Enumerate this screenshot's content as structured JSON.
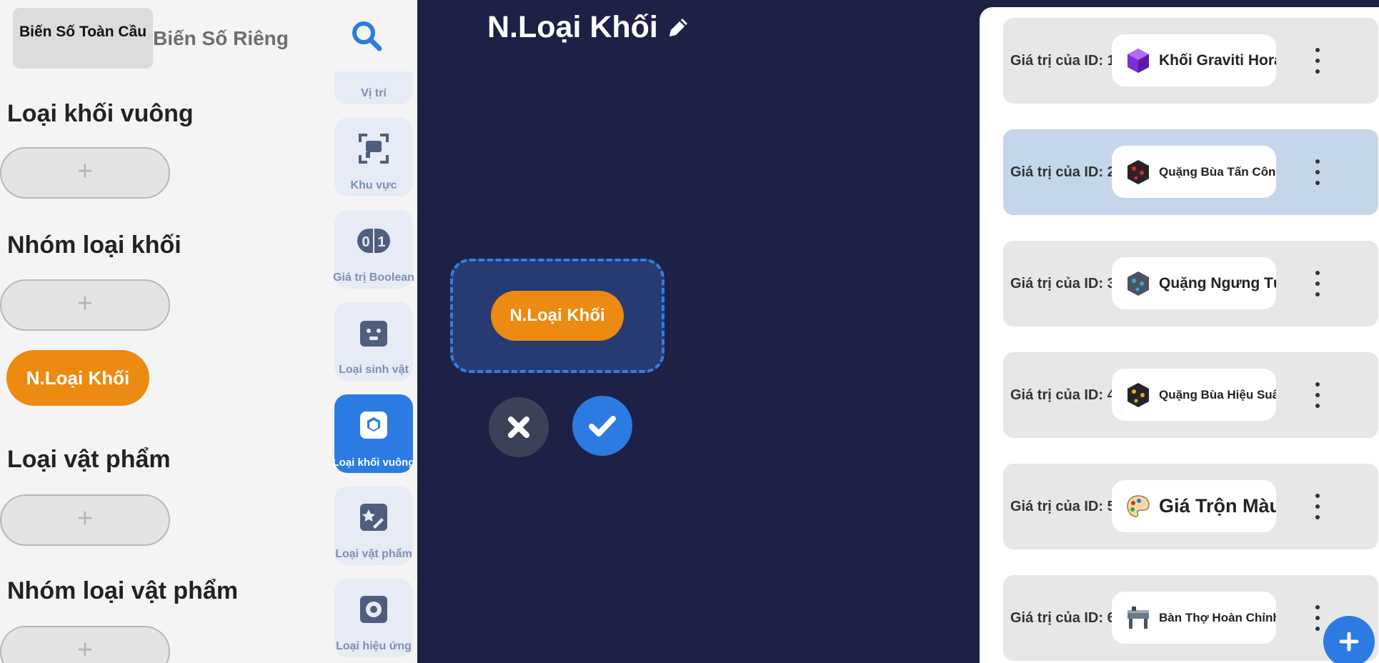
{
  "left_panel": {
    "tabs": [
      {
        "label": "Biến Số Toàn Cầu",
        "active": true
      },
      {
        "label": "Biến Số Riêng",
        "active": false
      }
    ],
    "sections": [
      {
        "title": "Loại khối vuông",
        "add_symbol": "+"
      },
      {
        "title": "Nhóm loại khối",
        "add_symbol": "+"
      },
      {
        "title": "Loại vật phẩm",
        "add_symbol": "+"
      },
      {
        "title": "Nhóm loại vật phẩm",
        "add_symbol": "+"
      }
    ],
    "variable_pill": "N.Loại Khối"
  },
  "rail": {
    "search_icon": "search-icon",
    "items": [
      {
        "label": "Vị trí",
        "icon": "location-icon",
        "active": false
      },
      {
        "label": "Khu vực",
        "icon": "area-icon",
        "active": false
      },
      {
        "label": "Giá trị Boolean",
        "icon": "boolean-icon",
        "active": false
      },
      {
        "label": "Loại sinh vật",
        "icon": "creature-icon",
        "active": false
      },
      {
        "label": "Loại khối vuông",
        "icon": "block-icon",
        "active": true
      },
      {
        "label": "Loại vật phẩm",
        "icon": "item-icon",
        "active": false
      },
      {
        "label": "Loại hiệu ứng",
        "icon": "effect-icon",
        "active": false
      }
    ]
  },
  "workspace": {
    "title": "N.Loại Khối",
    "edit_icon": "pencil-icon",
    "drop_pill": "N.Loại Khối",
    "cancel_icon": "close-icon",
    "confirm_icon": "check-icon"
  },
  "right_panel": {
    "rows": [
      {
        "label": "Giá trị của ID: 1",
        "value": "Khối Graviti Horas",
        "icon": "purple-crystal-block-icon",
        "selected": false
      },
      {
        "label": "Giá trị của ID: 2",
        "value": "Quặng Bùa Tấn Công",
        "icon": "red-ore-icon",
        "selected": true
      },
      {
        "label": "Giá trị của ID: 3",
        "value": "Quặng Ngưng Tụ",
        "icon": "blue-ore-icon",
        "selected": false
      },
      {
        "label": "Giá trị của ID: 4",
        "value": "Quặng Bùa Hiệu Suất",
        "icon": "gold-ore-icon",
        "selected": false
      },
      {
        "label": "Giá trị của ID: 5",
        "value": "Giá Trộn Màu",
        "icon": "palette-icon",
        "selected": false
      },
      {
        "label": "Giá trị của ID: 6",
        "value": "Bàn Thợ Hoàn Chỉnh",
        "icon": "workbench-icon",
        "selected": false
      }
    ],
    "more_icon": "more-vertical-icon",
    "add_icon": "plus-icon"
  },
  "colors": {
    "workspace_bg": "#1c2145",
    "accent_blue": "#2c7be3",
    "variable_orange": "#ec8a11",
    "selected_row": "#c6d6ea"
  }
}
